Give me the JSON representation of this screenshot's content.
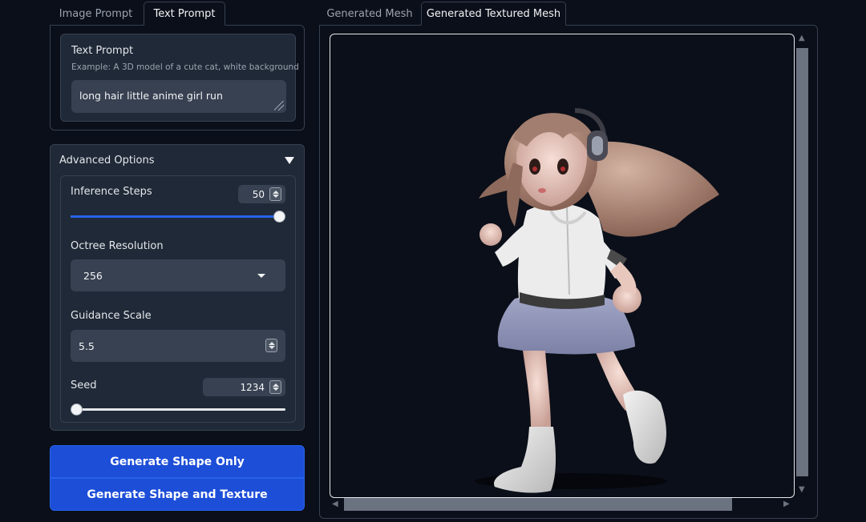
{
  "left_tabs": [
    {
      "label": "Image Prompt",
      "active": false
    },
    {
      "label": "Text Prompt",
      "active": true
    }
  ],
  "text_prompt": {
    "title": "Text Prompt",
    "hint": "Example: A 3D model of a cute cat, white background",
    "value": "long hair little anime girl run"
  },
  "advanced": {
    "title": "Advanced Options",
    "inference_steps": {
      "label": "Inference Steps",
      "value": "50",
      "slider_fraction": 1.0
    },
    "octree_resolution": {
      "label": "Octree Resolution",
      "value": "256"
    },
    "guidance_scale": {
      "label": "Guidance Scale",
      "value": "5.5"
    },
    "seed": {
      "label": "Seed",
      "value": "1234",
      "slider_fraction": 0.0
    }
  },
  "buttons": {
    "generate_shape": "Generate Shape Only",
    "generate_shape_texture": "Generate Shape and Texture"
  },
  "right_tabs": [
    {
      "label": "Generated Mesh",
      "active": false
    },
    {
      "label": "Generated Textured Mesh",
      "active": true
    }
  ],
  "colors": {
    "background": "#0b0f19",
    "panel": "#1f2937",
    "input": "#374151",
    "accent": "#1d4ed8",
    "slider": "#2563eb"
  }
}
